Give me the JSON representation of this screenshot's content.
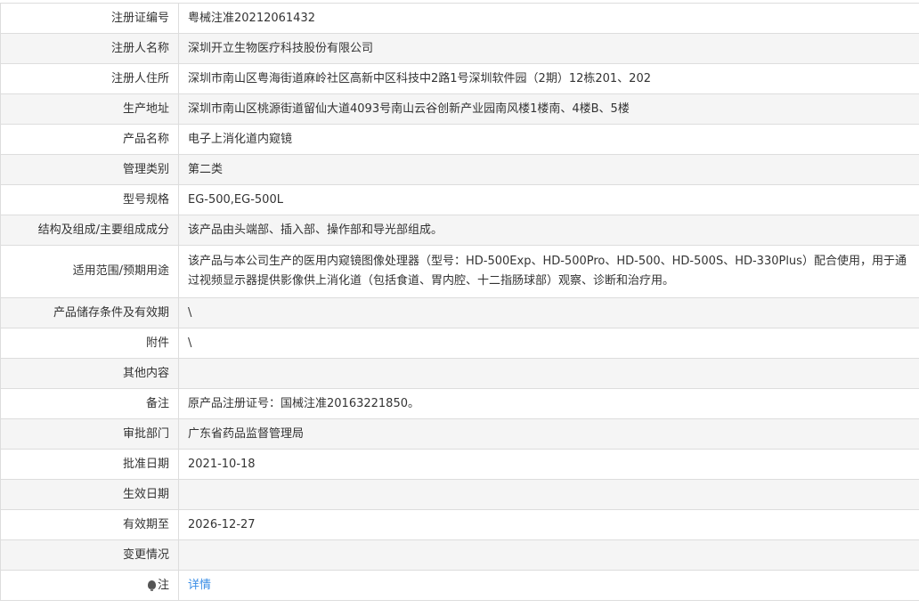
{
  "rows": [
    {
      "label": "注册证编号",
      "value": "粤械注准20212061432"
    },
    {
      "label": "注册人名称",
      "value": "深圳开立生物医疗科技股份有限公司"
    },
    {
      "label": "注册人住所",
      "value": "深圳市南山区粤海街道麻岭社区高新中区科技中2路1号深圳软件园（2期）12栋201、202"
    },
    {
      "label": "生产地址",
      "value": "深圳市南山区桃源街道留仙大道4093号南山云谷创新产业园南风楼1楼南、4楼B、5楼"
    },
    {
      "label": "产品名称",
      "value": "电子上消化道内窥镜"
    },
    {
      "label": "管理类别",
      "value": "第二类"
    },
    {
      "label": "型号规格",
      "value": "EG-500,EG-500L"
    },
    {
      "label": "结构及组成/主要组成成分",
      "value": "该产品由头端部、插入部、操作部和导光部组成。"
    },
    {
      "label": "适用范围/预期用途",
      "value": "该产品与本公司生产的医用内窥镜图像处理器（型号：HD-500Exp、HD-500Pro、HD-500、HD-500S、HD-330Plus）配合使用，用于通过视频显示器提供影像供上消化道（包括食道、胃内腔、十二指肠球部）观察、诊断和治疗用。"
    },
    {
      "label": "产品储存条件及有效期",
      "value": "\\"
    },
    {
      "label": "附件",
      "value": "\\"
    },
    {
      "label": "其他内容",
      "value": ""
    },
    {
      "label": "备注",
      "value": "原产品注册证号：国械注准20163221850。"
    },
    {
      "label": "审批部门",
      "value": "广东省药品监督管理局"
    },
    {
      "label": "批准日期",
      "value": "2021-10-18"
    },
    {
      "label": "生效日期",
      "value": ""
    },
    {
      "label": "有效期至",
      "value": "2026-12-27"
    },
    {
      "label": "变更情况",
      "value": ""
    },
    {
      "label": "注",
      "value": "详情",
      "icon": "lightbulb-icon"
    }
  ]
}
